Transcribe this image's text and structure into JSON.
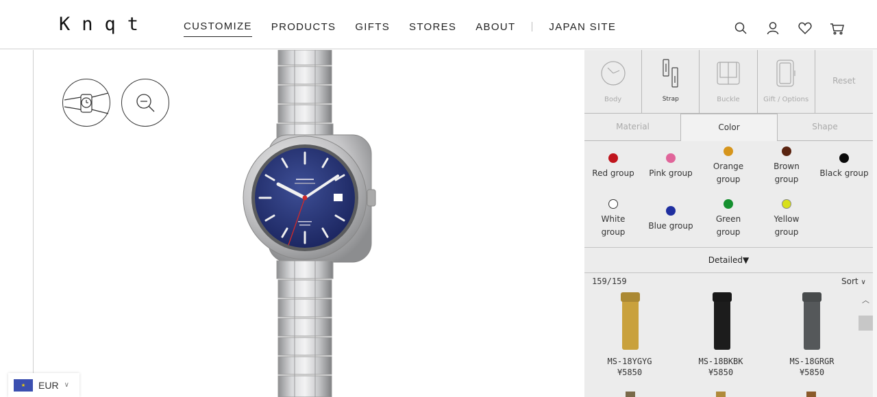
{
  "header": {
    "logo": "Knqt",
    "nav": [
      "CUSTOMIZE",
      "PRODUCTS",
      "GIFTS",
      "STORES",
      "ABOUT"
    ],
    "japan_site": "JAPAN SITE",
    "icons": [
      "search-icon",
      "account-icon",
      "heart-icon",
      "cart-icon"
    ]
  },
  "viewer": {
    "tools": [
      "wrist-view-icon",
      "zoom-out-icon"
    ]
  },
  "currency": {
    "code": "EUR"
  },
  "panel": {
    "categories": [
      {
        "label": "Body",
        "icon": "watch-body-icon"
      },
      {
        "label": "Strap",
        "icon": "strap-icon"
      },
      {
        "label": "Buckle",
        "icon": "buckle-icon"
      },
      {
        "label": "Gift / Options",
        "icon": "gift-box-icon"
      }
    ],
    "reset_label": "Reset",
    "tabs": [
      "Material",
      "Color",
      "Shape"
    ],
    "color_groups": [
      {
        "label": "Red group",
        "color": "#c0151d"
      },
      {
        "label": "Pink group",
        "color": "#e0659a"
      },
      {
        "label": "Orange group",
        "color": "#d6951c"
      },
      {
        "label": "Brown group",
        "color": "#5a2410"
      },
      {
        "label": "Black group",
        "color": "#0a0a0a"
      },
      {
        "label": "White group",
        "color": "#ffffff"
      },
      {
        "label": "Blue group",
        "color": "#1f2fa0"
      },
      {
        "label": "Green group",
        "color": "#15902f"
      },
      {
        "label": "Yellow group",
        "color": "#d8e01a"
      }
    ],
    "detailed_label": "Detailed▼",
    "count_label": "159/159",
    "sort_label": "Sort",
    "products": [
      {
        "code": "MS-18YGYG",
        "price": "¥5850",
        "color": "#c9a13c"
      },
      {
        "code": "MS-18BKBK",
        "price": "¥5850",
        "color": "#1c1c1c"
      },
      {
        "code": "MS-18GRGR",
        "price": "¥5850",
        "color": "#55585a"
      }
    ]
  }
}
